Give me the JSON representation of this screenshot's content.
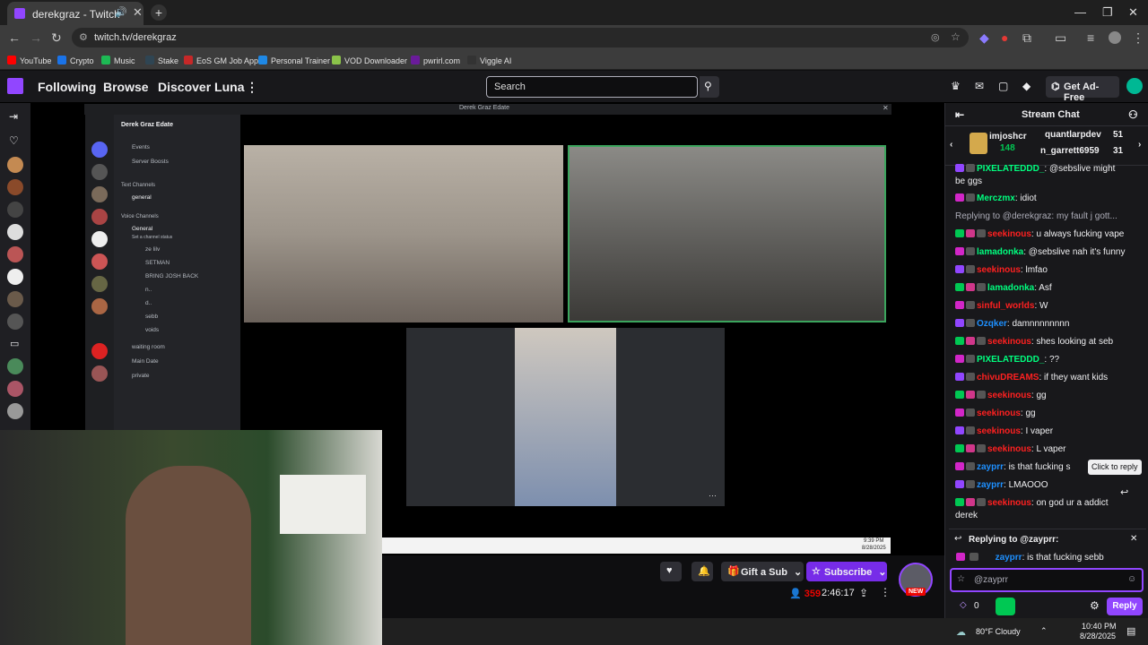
{
  "browser": {
    "tab_title": "derekgraz - Twitch",
    "url": "twitch.tv/derekgraz",
    "bookmarks": [
      {
        "label": "YouTube",
        "color": "#ff0000"
      },
      {
        "label": "Crypto",
        "color": "#1a73e8"
      },
      {
        "label": "Music",
        "color": "#1db954"
      },
      {
        "label": "Stake",
        "color": "#2f4553"
      },
      {
        "label": "EoS GM Job App",
        "color": "#c62828"
      },
      {
        "label": "Personal Trainer",
        "color": "#1e88e5"
      },
      {
        "label": "VOD Downloader",
        "color": "#8bc34a"
      },
      {
        "label": "pwrirl.com",
        "color": "#6a1b9a"
      },
      {
        "label": "Viggle AI",
        "color": "#333333"
      }
    ]
  },
  "topnav": {
    "following": "Following",
    "browse": "Browse",
    "discover": "Discover Luna",
    "search_placeholder": "Search",
    "get_ad_free": "Get Ad-Free"
  },
  "discord": {
    "window_title": "Derek Graz Edate",
    "server_name": "Derek Graz Edate",
    "items": [
      "Events",
      "Server Boosts",
      "Text Channels",
      "general",
      "Voice Channels",
      "General",
      "Set a channel status",
      "ze lilv",
      "SETMAN",
      "BRING JOSH BACK",
      "n..",
      "d..",
      "sebb",
      "voids",
      "waiting room",
      "Main Date",
      "private"
    ],
    "clock_time": "9:39 PM",
    "clock_date": "8/28/2025"
  },
  "stream": {
    "gift_sub": "Gift a Sub",
    "subscribe": "Subscribe",
    "viewers": "359",
    "uptime": "2:46:17",
    "new_badge": "NEW"
  },
  "chat": {
    "title": "Stream Chat",
    "leaderboard": [
      {
        "name": "imjoshcr",
        "value": "148"
      },
      {
        "name": "quantlarpdev",
        "value": "51"
      },
      {
        "name": "n_garrett6959",
        "value": "31"
      }
    ],
    "messages": [
      {
        "user": "PIXELATEDDD_",
        "color": "#00ff7f",
        "text": ": @sebslive might"
      },
      {
        "user": "",
        "color": "#efeff1",
        "text": "be ggs"
      },
      {
        "user": "Merczmx",
        "color": "#00ff7f",
        "text": ": idiot"
      },
      {
        "user": "",
        "color": "#adadb8",
        "text": "Replying to @derekgraz: my fault j gott..."
      },
      {
        "user": "seekinous",
        "color": "#ff2020",
        "text": ": u always fucking vape"
      },
      {
        "user": "lamadonka",
        "color": "#00ff7f",
        "text": ": @sebslive nah it's funny"
      },
      {
        "user": "seekinous",
        "color": "#ff2020",
        "text": ": lmfao"
      },
      {
        "user": "lamadonka",
        "color": "#00ff7f",
        "text": ": Asf"
      },
      {
        "user": "sinful_worlds",
        "color": "#ff2020",
        "text": ": W"
      },
      {
        "user": "Ozqker",
        "color": "#1e90ff",
        "text": ": damnnnnnnnn"
      },
      {
        "user": "seekinous",
        "color": "#ff2020",
        "text": ": shes looking at seb"
      },
      {
        "user": "PIXELATEDDD_",
        "color": "#00ff7f",
        "text": ": ??"
      },
      {
        "user": "chivuDREAMS",
        "color": "#ff2020",
        "text": ": if they want kids"
      },
      {
        "user": "seekinous",
        "color": "#ff2020",
        "text": ": gg"
      },
      {
        "user": "seekinous",
        "color": "#ff2020",
        "text": ": gg"
      },
      {
        "user": "seekinous",
        "color": "#ff2020",
        "text": ": I vaper"
      },
      {
        "user": "seekinous",
        "color": "#ff2020",
        "text": ": L vaper"
      },
      {
        "user": "zayprr",
        "color": "#1e90ff",
        "text": ": is that fucking s"
      },
      {
        "user": "zayprr",
        "color": "#1e90ff",
        "text": ": LMAOOO"
      },
      {
        "user": "seekinous",
        "color": "#ff2020",
        "text": ": on god ur a addict"
      },
      {
        "user": "",
        "color": "#efeff1",
        "text": "derek"
      }
    ],
    "tooltip": "Click to reply",
    "replying_to": "Replying to @zayprr:",
    "reply_preview_user": "zayprr",
    "reply_preview_text": ": is that fucking sebb",
    "input_value": "@zayprr",
    "points": "0",
    "reply_button": "Reply"
  },
  "taskbar": {
    "weather": "80°F  Cloudy",
    "time": "10:40 PM",
    "date": "8/28/2025"
  }
}
